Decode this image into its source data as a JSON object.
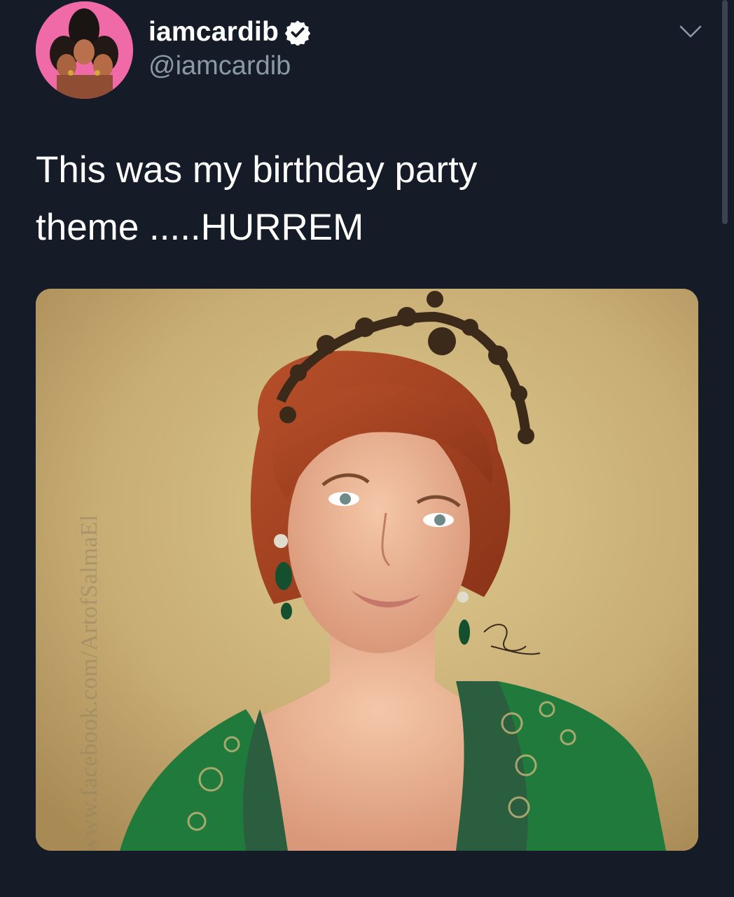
{
  "author": {
    "display_name": "iamcardib",
    "handle": "@iamcardib",
    "verified": true,
    "avatar_icon": "profile-avatar"
  },
  "tweet": {
    "text_line1": "This was my birthday party",
    "text_line2": "theme .....HURREM"
  },
  "media": {
    "description_icon": "portrait-image",
    "watermark": "https://www.facebook.com/ArtofSalmaEl"
  },
  "icons": {
    "verified": "verified-badge-icon",
    "more": "chevron-down-icon"
  },
  "colors": {
    "background": "#151c28",
    "handle": "#8b98a5",
    "avatar_bg": "#f06aa8"
  }
}
